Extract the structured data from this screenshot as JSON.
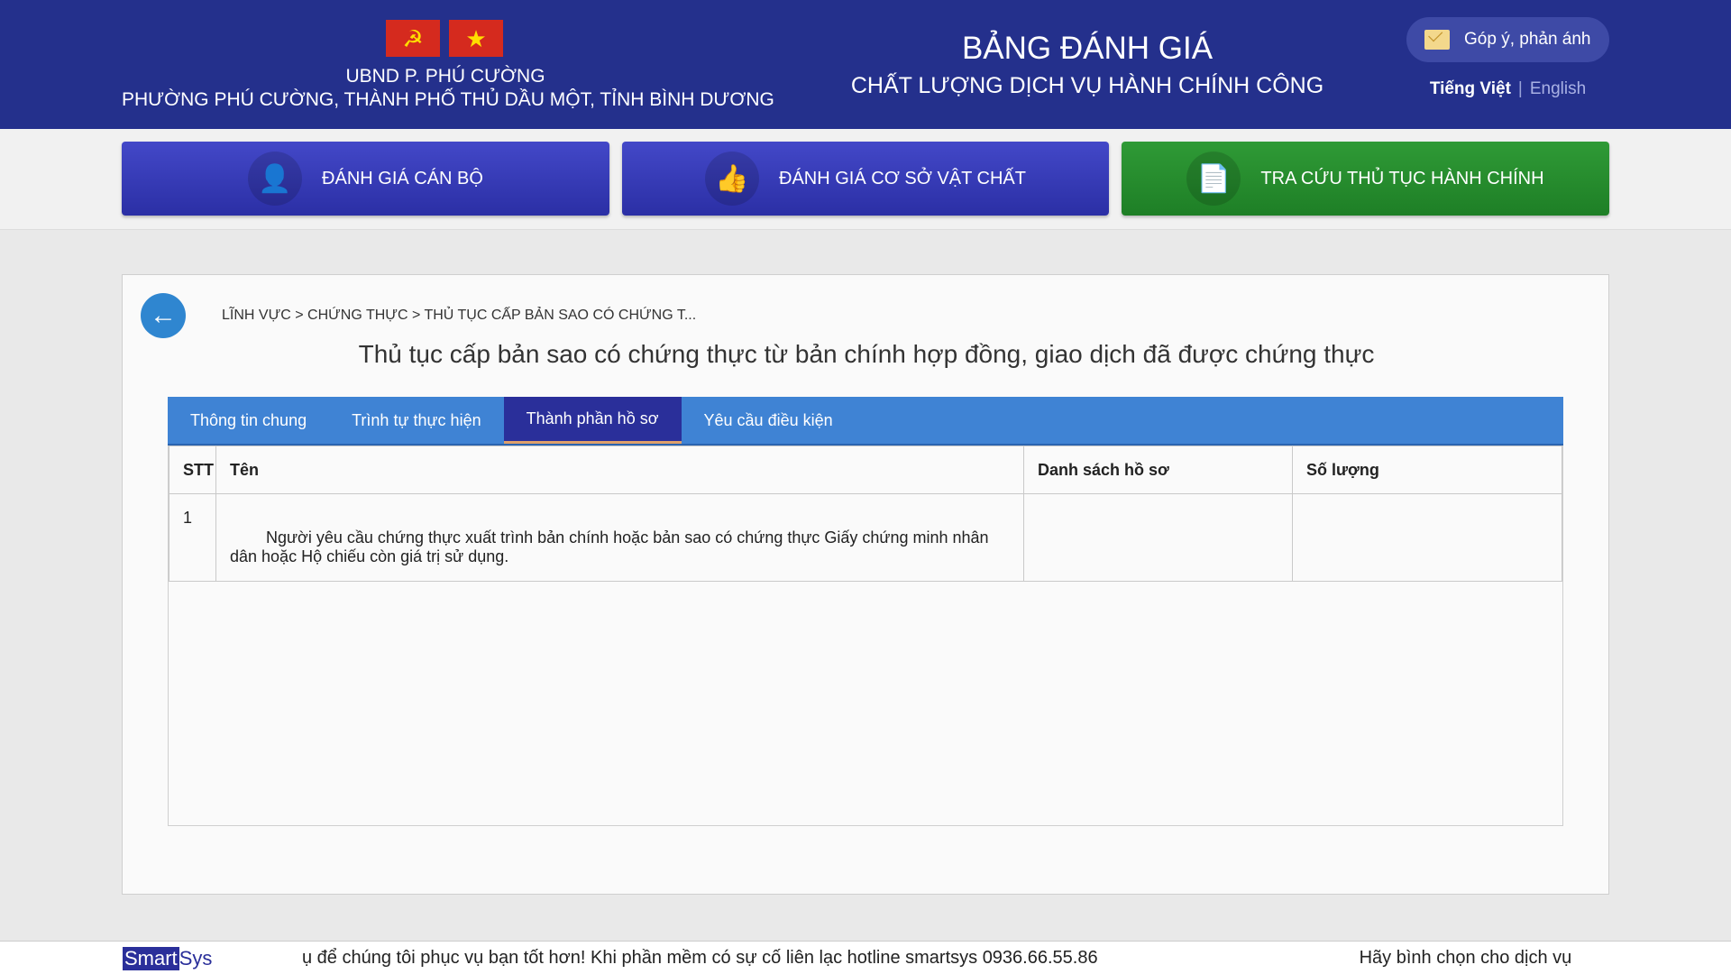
{
  "header": {
    "org_line1": "UBND P. PHÚ CƯỜNG",
    "org_line2": "PHƯỜNG PHÚ CƯỜNG, THÀNH PHỐ THỦ DẦU MỘT, TỈNH BÌNH DƯƠNG",
    "title_main": "BẢNG ĐÁNH GIÁ",
    "title_sub": "CHẤT LƯỢNG DỊCH VỤ HÀNH CHÍNH CÔNG",
    "feedback_label": "Góp ý, phản ánh",
    "lang_vi": "Tiếng Việt",
    "lang_sep": "|",
    "lang_en": "English",
    "flag_icons": [
      "party-flag-icon",
      "national-flag-icon"
    ]
  },
  "nav": {
    "items": [
      {
        "label": "ĐÁNH GIÁ CÁN BỘ",
        "icon": "officer-icon",
        "color": "#3337b5"
      },
      {
        "label": "ĐÁNH GIÁ CƠ SỞ VẬT CHẤT",
        "icon": "thumbs-up-icon",
        "color": "#3337b5"
      },
      {
        "label": "TRA CỨU THỦ TỤC HÀNH CHÍNH",
        "icon": "document-search-icon",
        "color": "#228a2b"
      }
    ]
  },
  "content": {
    "breadcrumb": "LĨNH VỰC > CHỨNG THỰC > THỦ TỤC CẤP BẢN SAO CÓ CHỨNG T...",
    "title": "Thủ tục cấp bản sao có chứng thực từ bản chính hợp đồng, giao dịch đã được chứng thực",
    "tabs": [
      {
        "label": "Thông tin chung",
        "active": false
      },
      {
        "label": "Trình tự thực hiện",
        "active": false
      },
      {
        "label": "Thành phần hồ sơ",
        "active": true
      },
      {
        "label": "Yêu cầu điều kiện",
        "active": false
      }
    ],
    "table": {
      "headers": [
        "STT",
        "Tên",
        "Danh sách hồ sơ",
        "Số lượng"
      ],
      "rows": [
        {
          "stt": "1",
          "name": "Người yêu cầu chứng thực xuất trình bản chính hoặc bản sao có chứng thực Giấy chứng minh nhân dân hoặc Hộ chiếu còn giá trị sử dụng.",
          "list": "",
          "qty": ""
        }
      ]
    }
  },
  "footer": {
    "logo_smart": "Smart",
    "logo_sys": "Sys",
    "ticker_text": "ụ để chúng tôi phục vụ bạn tốt hơn! Khi phần mềm có sự cố liên lạc hotline smartsys 0936.66.55.86",
    "ticker_text2": "Hãy bình chọn cho dịch vụ"
  }
}
